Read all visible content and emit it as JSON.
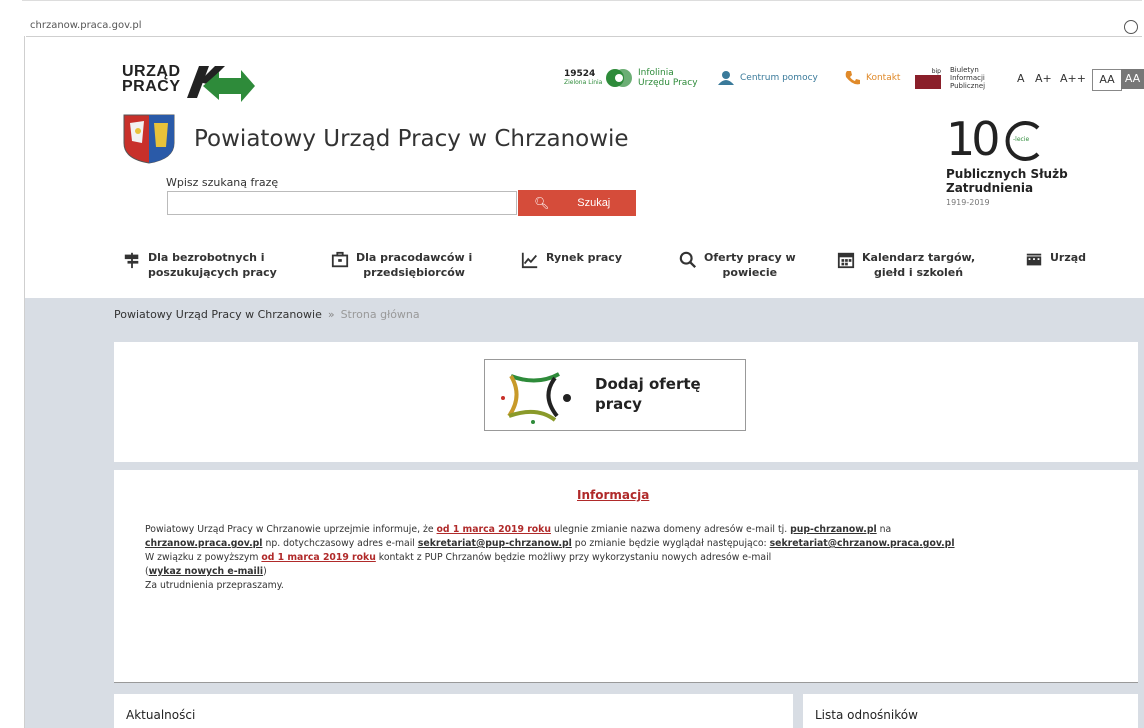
{
  "browser": {
    "url": "chrzanow.praca.gov.pl"
  },
  "logo": {
    "line1": "URZĄD",
    "line2": "PRACY"
  },
  "topbar": {
    "hotline_number": "19524",
    "hotline_sub": "Zielona Linia",
    "infolinia": "Infolinia Urzędu Pracy",
    "help": "Centrum pomocy",
    "contact": "Kontakt",
    "bip_badge": "bip",
    "bip": "Biuletyn Informacji Publicznej",
    "font_sizes": [
      "A",
      "A+",
      "A++"
    ],
    "contrast": [
      "AA",
      "AA"
    ]
  },
  "title": "Powiatowy Urząd Pracy w Chrzanowie",
  "anniversary": {
    "big": "10",
    "suffix": "-lecie",
    "line1": "Publicznych Służb",
    "line2": "Zatrudnienia",
    "years": "1919-2019"
  },
  "search": {
    "label": "Wpisz szukaną frazę",
    "placeholder": "",
    "button": "Szukaj"
  },
  "nav": [
    {
      "l1": "Dla bezrobotnych i",
      "l2": "poszukujących pracy",
      "icon": "signpost-icon"
    },
    {
      "l1": "Dla pracodawców i",
      "l2": "przedsiębiorców",
      "icon": "briefcase-icon"
    },
    {
      "l1": "Rynek pracy",
      "l2": "",
      "icon": "chart-icon"
    },
    {
      "l1": "Oferty pracy w",
      "l2": "powiecie",
      "icon": "search-icon"
    },
    {
      "l1": "Kalendarz targów,",
      "l2": "giełd i szkoleń",
      "icon": "calendar-icon"
    },
    {
      "l1": "Urząd",
      "l2": "",
      "icon": "building-icon"
    }
  ],
  "breadcrumb": {
    "home": "Powiatowy Urząd Pracy w Chrzanowie",
    "separator": "»",
    "current": "Strona główna"
  },
  "offer": {
    "line1": "Dodaj ofertę",
    "line2": "pracy"
  },
  "info": {
    "title": "Informacja",
    "p1a": "Powiatowy Urząd Pracy w Chrzanowie uprzejmie informuje, że ",
    "p1_link1": "od 1 marca 2019 roku",
    "p1b": " ulegnie zmianie nazwa domeny adresów e-mail tj. ",
    "p1_link2": "pup-chrzanow.pl",
    "p1c": " na",
    "p2_link1": "chrzanow.praca.gov.pl",
    "p2a": "  np. dotychczasowy adres e-mail ",
    "p2_link2": "sekretariat@pup-chrzanow.pl",
    "p2b": " po zmianie będzie wyglądał następująco: ",
    "p2_link3": "sekretariat@chrzanow.praca.gov.pl",
    "p3a": "W związku z powyższym ",
    "p3_link": "od 1 marca 2019 roku",
    "p3b": " kontakt z PUP Chrzanów będzie możliwy przy wykorzystaniu nowych adresów e-mail",
    "p4_open": "(",
    "p4_link": "wykaz nowych e-maili",
    "p4_close": ")",
    "p5": "Za utrudnienia przepraszamy."
  },
  "sections": {
    "news": "Aktualności",
    "links": "Lista odnośników"
  },
  "colors": {
    "accent": "#d54c3a",
    "link_red": "#b02a2a",
    "green": "#2e8b3a",
    "bg_gray": "#d8dde4"
  }
}
